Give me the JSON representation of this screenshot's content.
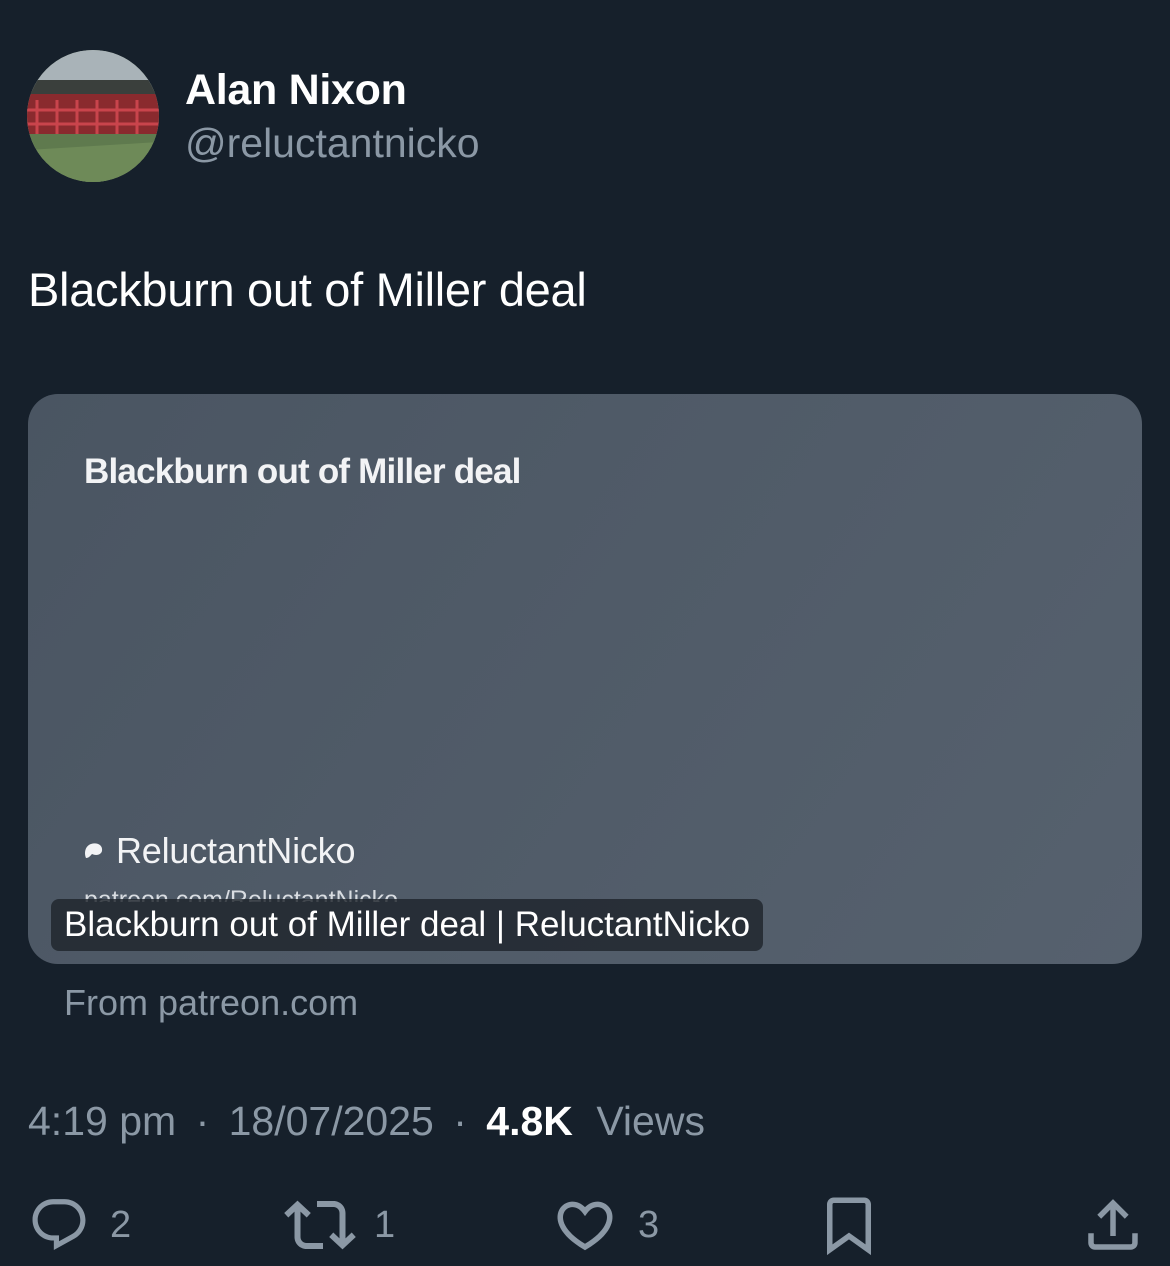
{
  "author": {
    "name": "Alan Nixon",
    "handle": "@reluctantnicko",
    "avatar_icon": "stadium-avatar"
  },
  "tweet": {
    "text": "Blackburn out of Miller deal"
  },
  "link_card": {
    "headline": "Blackburn out of Miller deal",
    "creator_icon": "patreon-icon",
    "creator_name": "ReluctantNicko",
    "creator_url": "patreon.com/ReluctantNicko",
    "overlay_title": "Blackburn out of Miller deal | ReluctantNicko",
    "source": "From patreon.com"
  },
  "meta": {
    "time": "4:19 pm",
    "separator": "·",
    "date": "18/07/2025",
    "views_count": "4.8K",
    "views_label": "Views"
  },
  "actions": {
    "reply": {
      "icon": "reply-icon",
      "count": "2"
    },
    "retweet": {
      "icon": "retweet-icon",
      "count": "1"
    },
    "like": {
      "icon": "heart-icon",
      "count": "3"
    },
    "bookmark": {
      "icon": "bookmark-icon"
    },
    "share": {
      "icon": "share-icon"
    }
  },
  "colors": {
    "background": "#16202b",
    "text_primary": "#ffffff",
    "text_secondary": "#8b98a5",
    "card_background": "#4f5a67"
  }
}
